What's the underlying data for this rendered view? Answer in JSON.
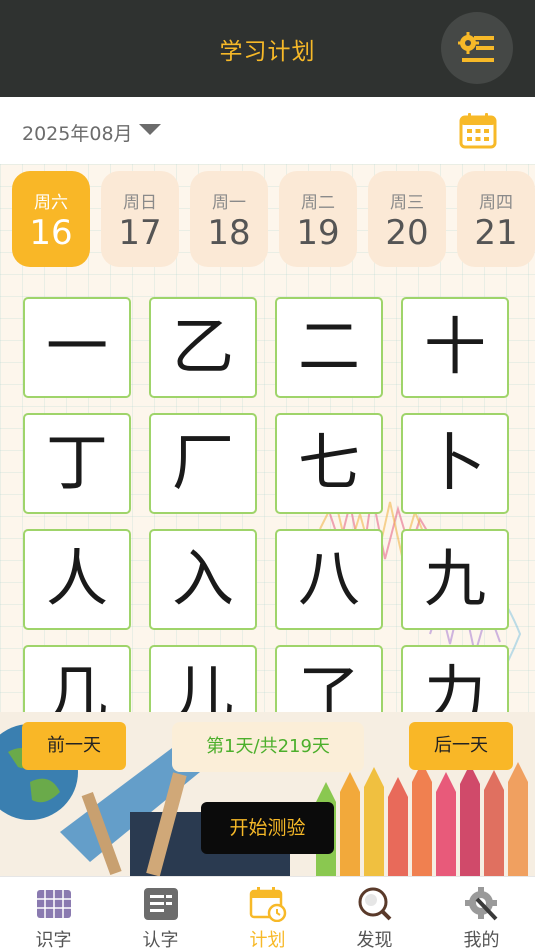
{
  "header": {
    "title": "学习计划",
    "settings_icon": "settings-list-icon"
  },
  "month": {
    "label": "2025年08月",
    "calendar_icon": "calendar-icon"
  },
  "days": [
    {
      "week": "周六",
      "num": "16",
      "active": true
    },
    {
      "week": "周日",
      "num": "17",
      "active": false
    },
    {
      "week": "周一",
      "num": "18",
      "active": false
    },
    {
      "week": "周二",
      "num": "19",
      "active": false
    },
    {
      "week": "周三",
      "num": "20",
      "active": false
    },
    {
      "week": "周四",
      "num": "21",
      "active": false
    }
  ],
  "characters": [
    "一",
    "乙",
    "二",
    "十",
    "丁",
    "厂",
    "七",
    "卜",
    "人",
    "入",
    "八",
    "九",
    "几",
    "儿",
    "了",
    "力"
  ],
  "controls": {
    "prev_label": "前一天",
    "progress": "第1天/共219天",
    "next_label": "后一天",
    "start_label": "开始测验"
  },
  "tabs": [
    {
      "label": "识字",
      "icon": "grid-book-icon",
      "active": false
    },
    {
      "label": "认字",
      "icon": "card-list-icon",
      "active": false
    },
    {
      "label": "计划",
      "icon": "calendar-clock-icon",
      "active": true
    },
    {
      "label": "发现",
      "icon": "magnifier-icon",
      "active": false
    },
    {
      "label": "我的",
      "icon": "gear-wrench-icon",
      "active": false
    }
  ],
  "colors": {
    "accent": "#f9b727",
    "header_bg": "#2f3230",
    "card_border": "#9fd46a",
    "progress_text": "#4caf2c"
  }
}
